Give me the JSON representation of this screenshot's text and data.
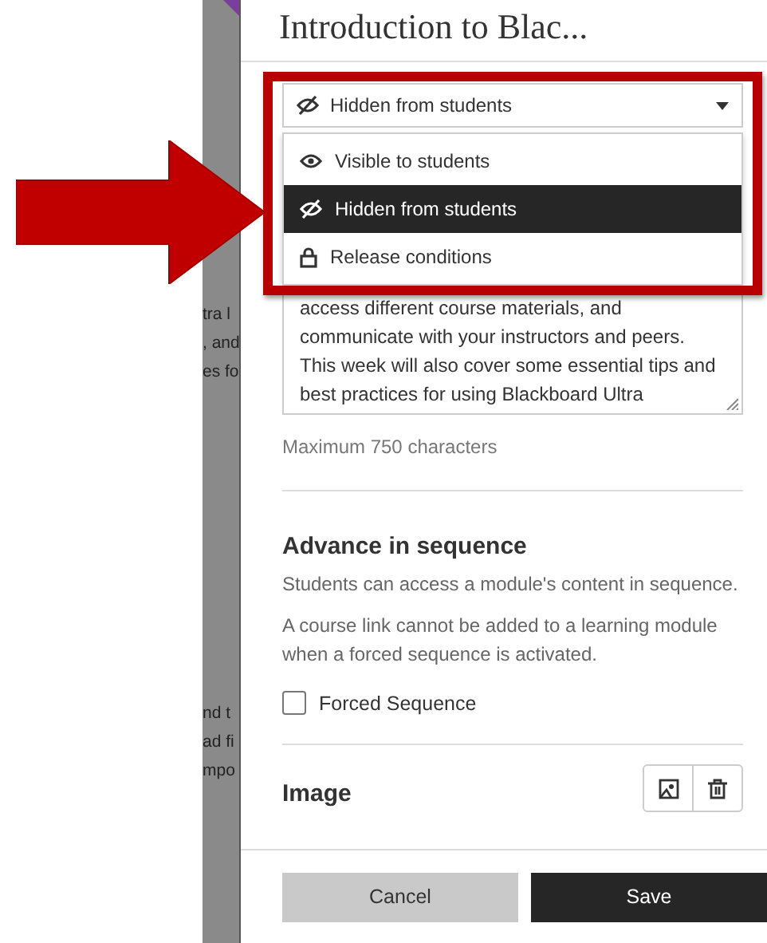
{
  "background_page": {
    "fragments_top": [
      "tra l",
      ", and",
      "es fo"
    ],
    "fragments_bottom": [
      "nd t",
      "ad fi",
      "mpo"
    ]
  },
  "panel": {
    "title": "Introduction to Blac...",
    "visibility": {
      "value": "Hidden from students",
      "options": [
        {
          "label": "Visible to students",
          "kind": "visible",
          "selected": false
        },
        {
          "label": "Hidden from students",
          "kind": "hidden",
          "selected": true
        },
        {
          "label": "Release conditions",
          "kind": "conditions",
          "selected": false
        }
      ]
    },
    "description": {
      "value": "access different course materials, and communicate with your instructors and peers. This week will also cover some essential tips and best practices for using Blackboard Ultra",
      "hint": "Maximum 750 characters"
    },
    "sequence": {
      "heading": "Advance in sequence",
      "text": "Students can access a module's content in sequence.",
      "note": "A course link cannot be added to a learning module when a forced sequence is activated.",
      "checkbox": {
        "label": "Forced Sequence",
        "checked": false
      }
    },
    "image": {
      "heading": "Image"
    },
    "buttons": {
      "cancel": "Cancel",
      "save": "Save"
    }
  }
}
